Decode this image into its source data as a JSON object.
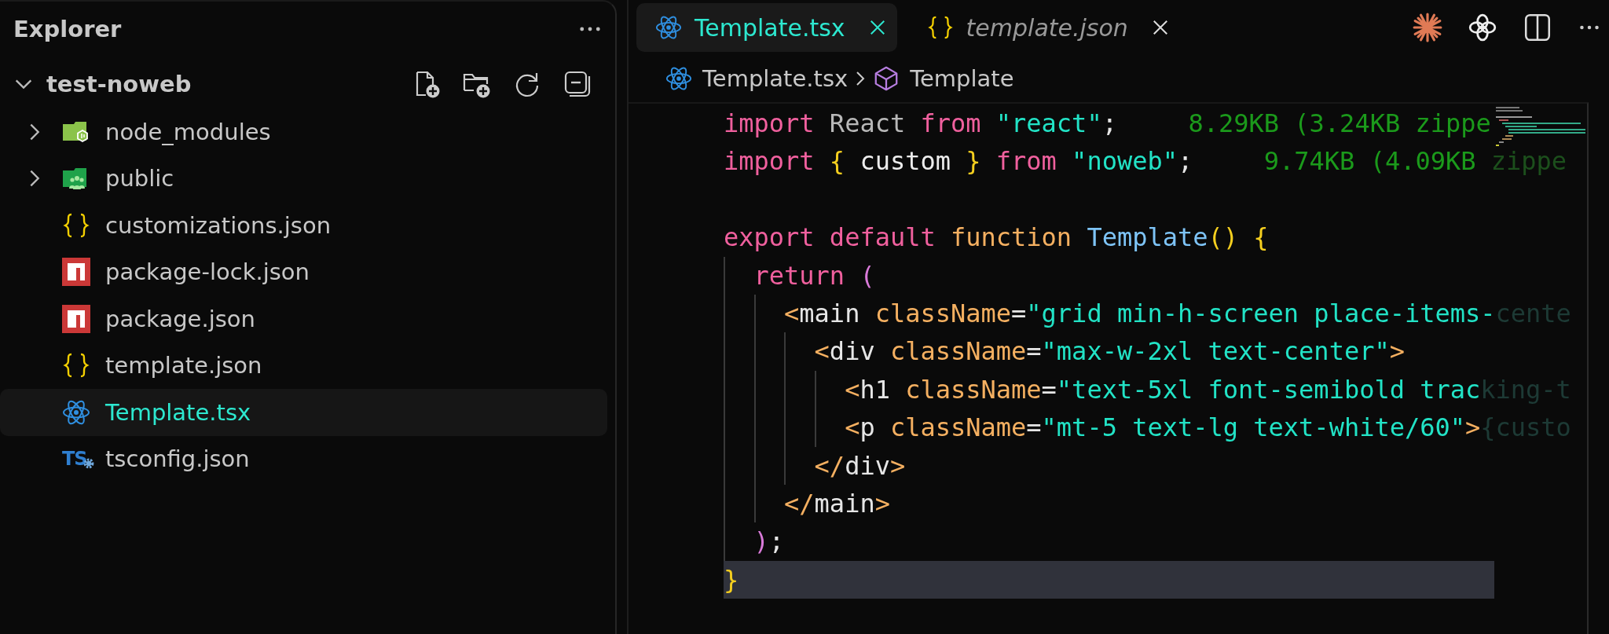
{
  "sidebar": {
    "title": "Explorer",
    "project": {
      "name": "test-noweb",
      "expanded": true
    },
    "items": [
      {
        "name": "node_modules",
        "kind": "node-folder",
        "expanded": false,
        "selected": false
      },
      {
        "name": "public",
        "kind": "people-folder",
        "expanded": false,
        "selected": false
      },
      {
        "name": "customizations.json",
        "kind": "json",
        "selected": false
      },
      {
        "name": "package-lock.json",
        "kind": "npm",
        "selected": false
      },
      {
        "name": "package.json",
        "kind": "npm",
        "selected": false
      },
      {
        "name": "template.json",
        "kind": "json",
        "selected": false
      },
      {
        "name": "Template.tsx",
        "kind": "react",
        "selected": true
      },
      {
        "name": "tsconfig.json",
        "kind": "ts",
        "label": "TS",
        "selected": false
      }
    ]
  },
  "tabs": [
    {
      "label": "Template.tsx",
      "kind": "react",
      "selected": true,
      "preview": false
    },
    {
      "label": "template.json",
      "kind": "json",
      "selected": false,
      "preview": true
    }
  ],
  "breadcrumb": [
    {
      "label": "Template.tsx",
      "kind": "react"
    },
    {
      "label": "Template",
      "kind": "symbol"
    }
  ],
  "code": {
    "lines": [
      {
        "current": false,
        "tokens": [
          {
            "kind": "keyword",
            "text": "import"
          },
          {
            "kind": "name",
            "text": " React "
          },
          {
            "kind": "keyword",
            "text": "from"
          },
          {
            "kind": "string",
            "text": " \"react\""
          },
          {
            "kind": "punct",
            "text": ";"
          },
          {
            "kind": "size",
            "text": "8.29KB (3.24KB zippe"
          }
        ]
      },
      {
        "current": false,
        "tokens": [
          {
            "kind": "keyword",
            "text": "import"
          },
          {
            "kind": "brace",
            "text": " {"
          },
          {
            "kind": "plain",
            "text": " custom "
          },
          {
            "kind": "brace",
            "text": "}"
          },
          {
            "kind": "keyword",
            "text": " from"
          },
          {
            "kind": "string",
            "text": " \"noweb\""
          },
          {
            "kind": "punct",
            "text": ";"
          },
          {
            "kind": "size",
            "text": "9.74KB (4.09KB "
          },
          {
            "kind": "faded-size",
            "text": "zippe"
          }
        ]
      },
      {
        "current": false
      },
      {
        "current": false,
        "tokens": [
          {
            "kind": "keyword",
            "text": "export"
          },
          {
            "kind": "keyword",
            "text": " default"
          },
          {
            "kind": "storage",
            "text": " function"
          },
          {
            "kind": "function",
            "text": " Template"
          },
          {
            "kind": "brace",
            "text": "() {"
          }
        ],
        "children": [
          {
            "current": false,
            "tokens": [
              {
                "kind": "keyword",
                "text": "return"
              },
              {
                "kind": "paren",
                "text": " ("
              }
            ],
            "children": [
              {
                "current": false,
                "tokens": [
                  {
                    "kind": "tag-bracket",
                    "text": "<"
                  },
                  {
                    "kind": "tag",
                    "text": "main"
                  },
                  {
                    "kind": "attribute",
                    "text": " className"
                  },
                  {
                    "kind": "punct",
                    "text": "="
                  },
                  {
                    "kind": "string",
                    "text": "\"grid min-h-screen place-items-"
                  },
                  {
                    "kind": "faded",
                    "text": "cente"
                  }
                ],
                "children": [
                  {
                    "current": false,
                    "tokens": [
                      {
                        "kind": "tag-bracket",
                        "text": "<"
                      },
                      {
                        "kind": "tag",
                        "text": "div"
                      },
                      {
                        "kind": "attribute",
                        "text": " className"
                      },
                      {
                        "kind": "punct",
                        "text": "="
                      },
                      {
                        "kind": "string",
                        "text": "\"max-w-2xl text-center\""
                      },
                      {
                        "kind": "tag-bracket",
                        "text": ">"
                      }
                    ],
                    "children": [
                      {
                        "current": false,
                        "tokens": [
                          {
                            "kind": "tag-bracket",
                            "text": "<"
                          },
                          {
                            "kind": "tag",
                            "text": "h1"
                          },
                          {
                            "kind": "attribute",
                            "text": " className"
                          },
                          {
                            "kind": "punct",
                            "text": "="
                          },
                          {
                            "kind": "string",
                            "text": "\"text-5xl font-semibold trac"
                          },
                          {
                            "kind": "faded",
                            "text": "king-t"
                          }
                        ]
                      },
                      {
                        "current": false,
                        "tokens": [
                          {
                            "kind": "tag-bracket",
                            "text": "<"
                          },
                          {
                            "kind": "tag",
                            "text": "p"
                          },
                          {
                            "kind": "attribute",
                            "text": " className"
                          },
                          {
                            "kind": "punct",
                            "text": "="
                          },
                          {
                            "kind": "string",
                            "text": "\"mt-5 text-lg text-white/60\""
                          },
                          {
                            "kind": "tag-bracket",
                            "text": ">"
                          },
                          {
                            "kind": "faded",
                            "text": "{custo"
                          }
                        ]
                      }
                    ]
                  },
                  {
                    "current": false,
                    "tokens": [
                      {
                        "kind": "tag-bracket",
                        "text": "</"
                      },
                      {
                        "kind": "tag",
                        "text": "div"
                      },
                      {
                        "kind": "tag-bracket",
                        "text": ">"
                      }
                    ]
                  }
                ]
              },
              {
                "current": false,
                "tokens": [
                  {
                    "kind": "tag-bracket",
                    "text": "</"
                  },
                  {
                    "kind": "tag",
                    "text": "main"
                  },
                  {
                    "kind": "tag-bracket",
                    "text": ">"
                  }
                ]
              }
            ]
          },
          {
            "current": false,
            "tokens": [
              {
                "kind": "paren",
                "text": ")"
              },
              {
                "kind": "punct",
                "text": ";"
              }
            ]
          }
        ]
      },
      {
        "current": true,
        "tokens": [
          {
            "kind": "brace",
            "text": "}"
          }
        ]
      }
    ]
  }
}
